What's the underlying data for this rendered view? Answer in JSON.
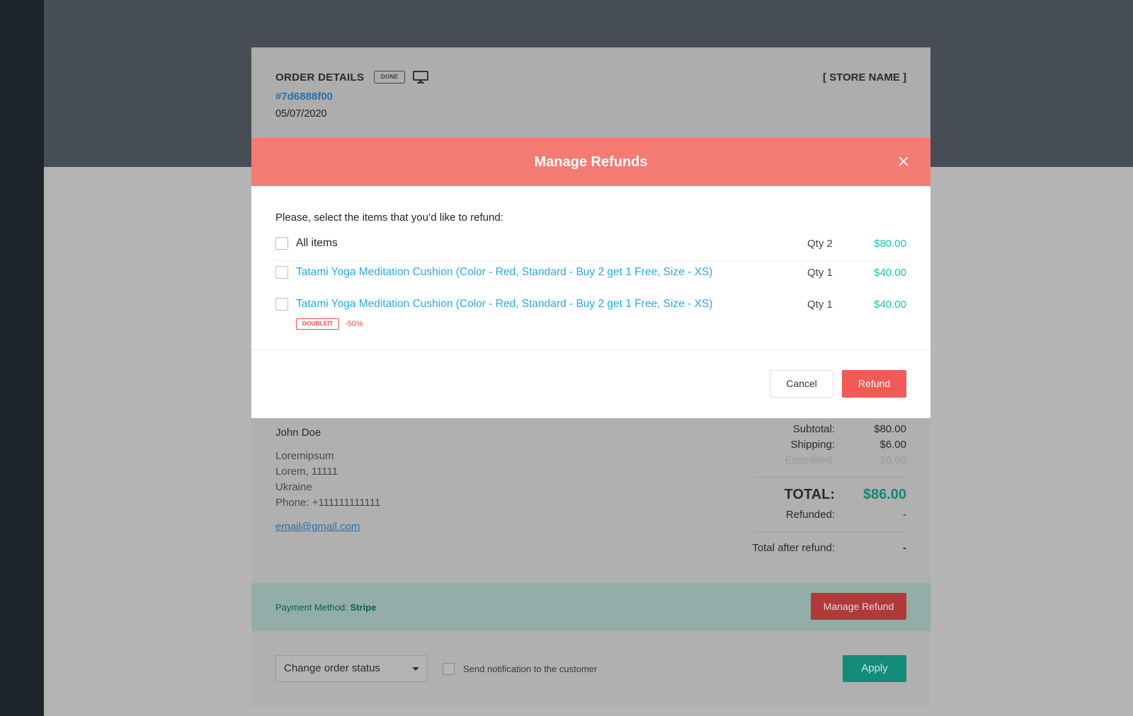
{
  "order": {
    "title": "ORDER DETAILS",
    "status_badge": "DONE",
    "device_icon": "desktop-monitor-icon",
    "id": "#7d6888f00",
    "date": "05/07/2020",
    "store_name": "[ STORE NAME ]"
  },
  "customer": {
    "name": "John Doe",
    "address_line1": "Loremipsum",
    "address_line2": "Lorem, 11111",
    "country": "Ukraine",
    "phone": "Phone: +111111111111",
    "email": "email@gmail.com"
  },
  "summary": {
    "subtotal_label": "Subtotal:",
    "subtotal_value": "$80.00",
    "shipping_label": "Shipping:",
    "shipping_value": "$6.00",
    "expedited_label": "Expedited:",
    "expedited_value": "$6.00",
    "total_label": "TOTAL:",
    "total_value": "$86.00",
    "refunded_label": "Refunded:",
    "refunded_value": "-",
    "after_refund_label": "Total after refund:",
    "after_refund_value": "-"
  },
  "payment": {
    "label": "Payment Method:",
    "method": "Stripe",
    "manage_refund_label": "Manage Refund"
  },
  "status_bar": {
    "select_value": "Change order status",
    "notify_label": "Send notification to the customer",
    "apply_label": "Apply"
  },
  "modal": {
    "title": "Manage Refunds",
    "intro": "Please, select the items that you’d like to refund:",
    "items": [
      {
        "label": "All items",
        "qty": "Qty 2",
        "price": "$80.00"
      },
      {
        "label": "Tatami Yoga Meditation Cushion (Color - Red, Standard - Buy 2 get 1 Free, Size - XS)",
        "qty": "Qty 1",
        "price": "$40.00"
      },
      {
        "label": "Tatami Yoga Meditation Cushion (Color - Red, Standard - Buy 2 get 1 Free, Size - XS)",
        "qty": "Qty 1",
        "price": "$40.00",
        "promo_code": "DOUBLEIT",
        "promo_discount": "-50%"
      }
    ],
    "cancel_label": "Cancel",
    "refund_label": "Refund"
  },
  "colors": {
    "modal_header": "#f47a74",
    "price": "#17c3b2",
    "link": "#2aa9de",
    "refund_button": "#f25a55",
    "apply_button": "#138c79"
  }
}
